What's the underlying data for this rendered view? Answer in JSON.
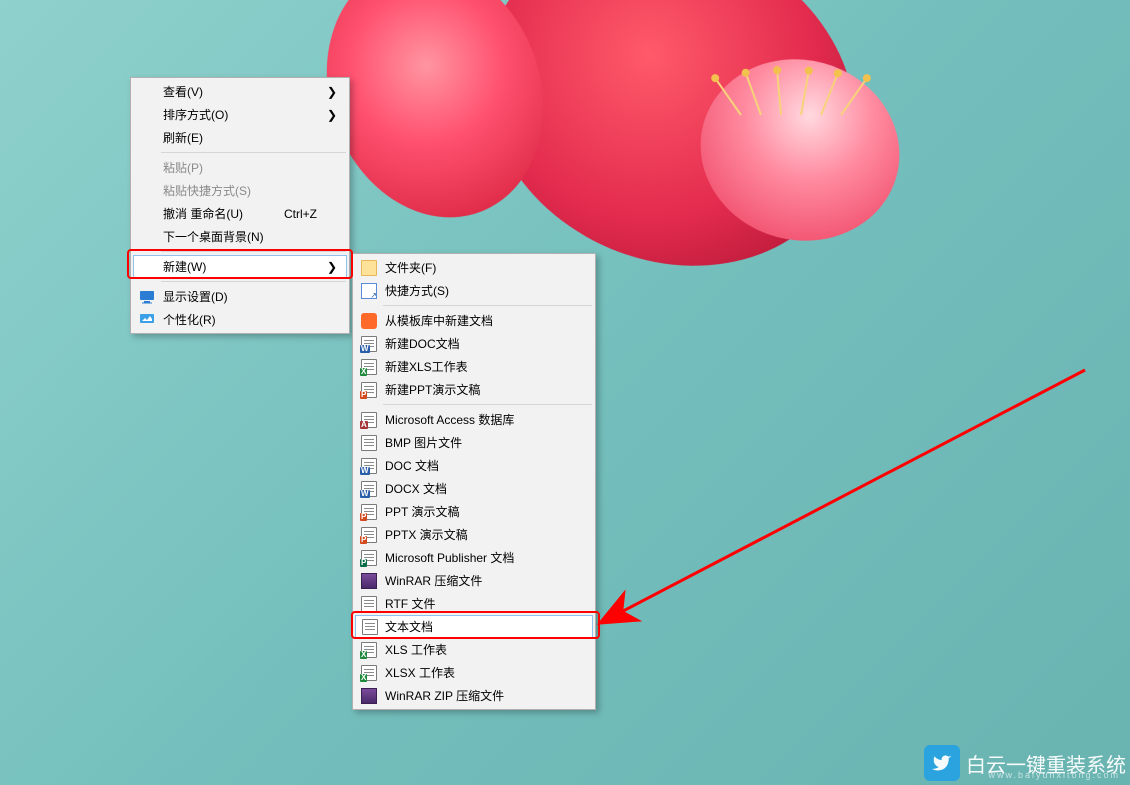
{
  "context_menu": {
    "items": [
      {
        "label": "查看(V)",
        "has_submenu": true
      },
      {
        "label": "排序方式(O)",
        "has_submenu": true
      },
      {
        "label": "刷新(E)"
      },
      {
        "label": "粘贴(P)",
        "disabled": true
      },
      {
        "label": "粘贴快捷方式(S)",
        "disabled": true
      },
      {
        "label": "撤消 重命名(U)",
        "shortcut": "Ctrl+Z"
      },
      {
        "label": "下一个桌面背景(N)"
      },
      {
        "label": "新建(W)",
        "has_submenu": true,
        "highlighted": true
      },
      {
        "label": "显示设置(D)",
        "icon": "display-settings-icon"
      },
      {
        "label": "个性化(R)",
        "icon": "personalize-icon"
      }
    ]
  },
  "new_submenu": {
    "items": [
      {
        "label": "文件夹(F)",
        "icon": "folder-icon"
      },
      {
        "label": "快捷方式(S)",
        "icon": "shortcut-icon"
      },
      {
        "label": "从模板库中新建文档",
        "icon": "wps-template-icon"
      },
      {
        "label": "新建DOC文档",
        "icon": "doc-icon"
      },
      {
        "label": "新建XLS工作表",
        "icon": "xls-icon"
      },
      {
        "label": "新建PPT演示文稿",
        "icon": "ppt-icon"
      },
      {
        "label": "Microsoft Access 数据库",
        "icon": "access-icon"
      },
      {
        "label": "BMP 图片文件",
        "icon": "bmp-icon"
      },
      {
        "label": "DOC 文档",
        "icon": "doc-icon"
      },
      {
        "label": "DOCX 文档",
        "icon": "docx-icon"
      },
      {
        "label": "PPT 演示文稿",
        "icon": "ppt-icon"
      },
      {
        "label": "PPTX 演示文稿",
        "icon": "pptx-icon"
      },
      {
        "label": "Microsoft Publisher 文档",
        "icon": "publisher-icon"
      },
      {
        "label": "WinRAR 压缩文件",
        "icon": "rar-icon"
      },
      {
        "label": "RTF 文件",
        "icon": "rtf-icon"
      },
      {
        "label": "文本文档",
        "icon": "txt-icon",
        "highlighted": true
      },
      {
        "label": "XLS 工作表",
        "icon": "xls-icon"
      },
      {
        "label": "XLSX 工作表",
        "icon": "xlsx-icon"
      },
      {
        "label": "WinRAR ZIP 压缩文件",
        "icon": "zip-icon"
      }
    ]
  },
  "annotations": {
    "highlight_color": "#ff0000",
    "arrow_from": "top-right",
    "arrow_to": "文本文档"
  },
  "watermark": {
    "text": "白云一键重装系统",
    "subtext": "www.baiyunxitong.com"
  }
}
